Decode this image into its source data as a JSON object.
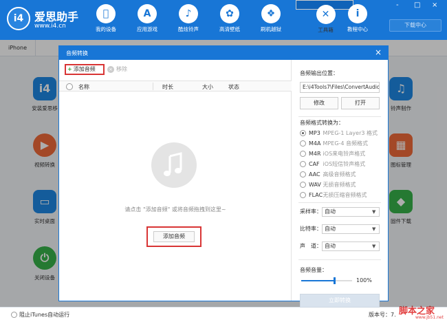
{
  "app": {
    "brand": "爱思助手",
    "url": "www.i4.cn",
    "logo_text": "i4",
    "nav": [
      {
        "label": "我的设备",
        "icon": "apple-icon"
      },
      {
        "label": "应用游戏",
        "icon": "app-store-icon"
      },
      {
        "label": "酷炫铃声",
        "icon": "bell-icon"
      },
      {
        "label": "高清壁纸",
        "icon": "flower-icon"
      },
      {
        "label": "刷机越狱",
        "icon": "dropbox-icon"
      },
      {
        "label": "工具箱",
        "icon": "tools-icon"
      },
      {
        "label": "教程中心",
        "icon": "info-icon"
      }
    ],
    "download_center": "下载中心",
    "window_controls": [
      "-",
      "□",
      "×"
    ]
  },
  "device_tab": "iPhone",
  "tools": [
    {
      "label": "安装爱思移",
      "icon": "i4-icon",
      "color": "#1e88e5"
    },
    {
      "label": "视频转换",
      "icon": "play-icon",
      "color": "#f06b3a"
    },
    {
      "label": "实时桌面",
      "icon": "monitor-icon",
      "color": "#1e88e5"
    },
    {
      "label": "关闭设备",
      "icon": "power-icon",
      "color": "#37b34a"
    },
    {
      "label": "铃声制作",
      "icon": "bell-icon",
      "color": "#1e88e5"
    },
    {
      "label": "图标管理",
      "icon": "grid-icon",
      "color": "#f06b3a"
    },
    {
      "label": "固件下载",
      "icon": "box-icon",
      "color": "#37b34a"
    }
  ],
  "statusbar": {
    "itunes": "阻止iTunes自动运行",
    "version": "版本号：7."
  },
  "watermark": {
    "main": "脚本之家",
    "sub": "www.jb51.net"
  },
  "dialog": {
    "title": "音频转换",
    "close": "×",
    "toolbar": {
      "add": "添加音频",
      "remove": "移除"
    },
    "columns": [
      "名称",
      "时长",
      "大小",
      "状态"
    ],
    "empty_hint": "请点击 \"添加音频\" 或将音频拖拽到这里~",
    "add_center": "添加音频",
    "output_label": "音频输出位置：",
    "output_path": "E:\\i4Tools7\\Files\\ConvertAudio",
    "modify": "修改",
    "open": "打开",
    "format_label": "音频格式转换为：",
    "formats": [
      {
        "name": "MP3",
        "desc": "MPEG-1 Layer3 格式",
        "selected": true
      },
      {
        "name": "M4A",
        "desc": "MPEG-4 音频格式",
        "selected": false
      },
      {
        "name": "M4R",
        "desc": "iOS来电铃声格式",
        "selected": false
      },
      {
        "name": "CAF",
        "desc": "iOS短信铃声格式",
        "selected": false
      },
      {
        "name": "AAC",
        "desc": "高级音频格式",
        "selected": false
      },
      {
        "name": "WAV",
        "desc": "无损音频格式",
        "selected": false
      },
      {
        "name": "FLAC",
        "desc": "无损压缩音频格式",
        "selected": false
      }
    ],
    "sample_rate": {
      "label": "采样率：",
      "value": "自动"
    },
    "bit_rate": {
      "label": "比特率：",
      "value": "自动"
    },
    "channel": {
      "label": "声　道：",
      "value": "自动"
    },
    "volume_label": "音频音量：",
    "volume_value": "100%",
    "volume_fraction": 0.65,
    "convert": "立即转换"
  }
}
